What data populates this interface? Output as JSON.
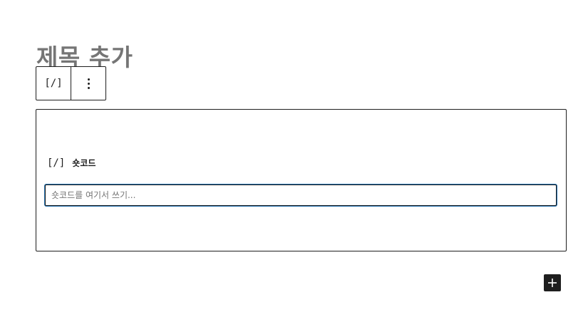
{
  "editor": {
    "title_placeholder": "제목 추가"
  },
  "block_toolbar": {
    "block_type_icon": "[/]",
    "block_type_icon_name": "shortcode-icon",
    "options_icon_name": "more-vertical-icon"
  },
  "shortcode_block": {
    "icon": "[/]",
    "label": "숏코드",
    "input_value": "",
    "input_placeholder": "숏코드를 여기서 쓰기..."
  },
  "inserter": {
    "icon_name": "plus-icon"
  },
  "colors": {
    "text": "#1e1e1e",
    "placeholder": "#757575",
    "focus": "#2271b1",
    "inserter_bg": "#1e1e1e"
  }
}
